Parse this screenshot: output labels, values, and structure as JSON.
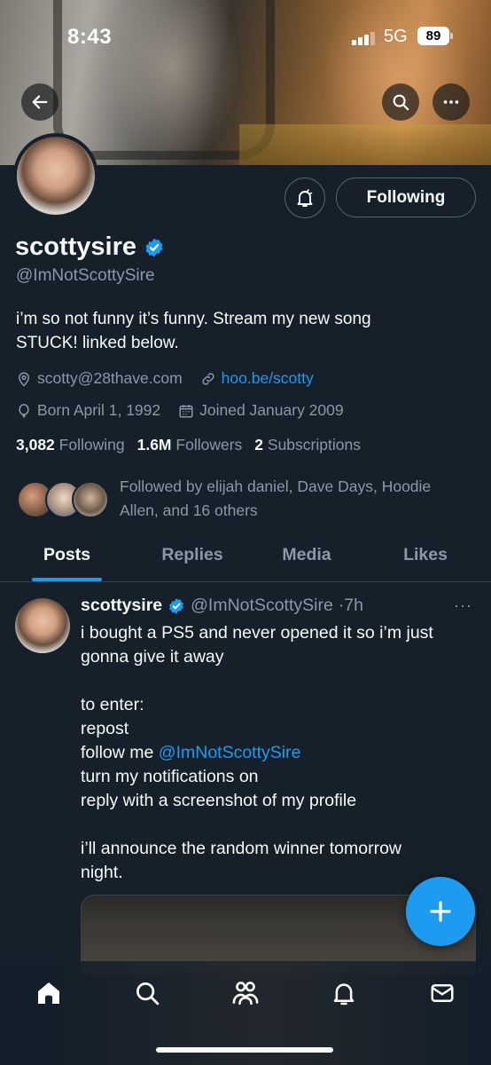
{
  "status_bar": {
    "time": "8:43",
    "network": "5G",
    "battery": "89"
  },
  "profile": {
    "name": "scottysire",
    "handle": "@ImNotScottySire",
    "bio_line1": "i’m so not funny it’s funny. Stream my new song",
    "bio_line2": "STUCK! linked below.",
    "location": "scotty@28thave.com",
    "website": "hoo.be/scotty",
    "birthday": "Born April 1, 1992",
    "joined": "Joined January 2009",
    "following_count": "3,082",
    "following_label": "Following",
    "followers_count": "1.6M",
    "followers_label": "Followers",
    "subscriptions_count": "2",
    "subscriptions_label": "Subscriptions",
    "followed_by_line1": "Followed by elijah daniel, Dave Days, Hoodie",
    "followed_by_line2": "Allen, and 16 others",
    "follow_button_label": "Following"
  },
  "tabs": [
    {
      "label": "Posts",
      "active": true
    },
    {
      "label": "Replies",
      "active": false
    },
    {
      "label": "Media",
      "active": false
    },
    {
      "label": "Likes",
      "active": false
    }
  ],
  "post": {
    "name": "scottysire",
    "handle": "@ImNotScottySire",
    "time": "·7h",
    "more": "···",
    "lines": [
      "i bought a PS5 and never opened it so i’m just",
      "gonna give it away",
      "to enter:",
      "repost",
      "follow me ",
      "turn my notifications on",
      "reply with a screenshot of my profile",
      "i’ll announce the random winner tomorrow",
      "night."
    ],
    "mention": "@ImNotScottySire"
  },
  "icons": {
    "back": "arrow-left-icon",
    "search": "search-icon",
    "more": "more-icon",
    "bell": "bell-icon",
    "verified": "verified-badge-icon",
    "location": "location-icon",
    "link": "link-icon",
    "birthday": "balloon-icon",
    "calendar": "calendar-icon",
    "compose": "plus-icon"
  },
  "colors": {
    "accent": "#1d9bf0",
    "background": "#15202b",
    "muted": "#8b98a5"
  }
}
